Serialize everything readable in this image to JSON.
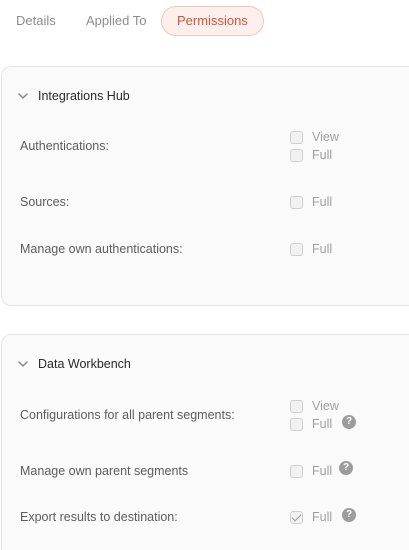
{
  "tabs": {
    "details": "Details",
    "applied_to": "Applied To",
    "permissions": "Permissions"
  },
  "colors": {
    "active_tab_text": "#d2553a",
    "active_tab_bg": "#fdf0ec",
    "card_bg": "#fafafa"
  },
  "sections": [
    {
      "title": "Integrations Hub",
      "rows": [
        {
          "label": "Authentications:",
          "options": [
            {
              "label": "View",
              "checked": false
            },
            {
              "label": "Full",
              "checked": false
            }
          ]
        },
        {
          "label": "Sources:",
          "options": [
            {
              "label": "Full",
              "checked": false
            }
          ]
        },
        {
          "label": "Manage own authentications:",
          "options": [
            {
              "label": "Full",
              "checked": false
            }
          ]
        }
      ]
    },
    {
      "title": "Data Workbench",
      "rows": [
        {
          "label": "Configurations for all parent segments:",
          "options": [
            {
              "label": "View",
              "checked": false
            },
            {
              "label": "Full",
              "checked": false
            }
          ],
          "help": "?"
        },
        {
          "label": "Manage own parent segments",
          "options": [
            {
              "label": "Full",
              "checked": false
            }
          ],
          "help": "?"
        },
        {
          "label": "Export results to destination:",
          "options": [
            {
              "label": "Full",
              "checked": true
            }
          ],
          "help": "?"
        }
      ]
    }
  ]
}
